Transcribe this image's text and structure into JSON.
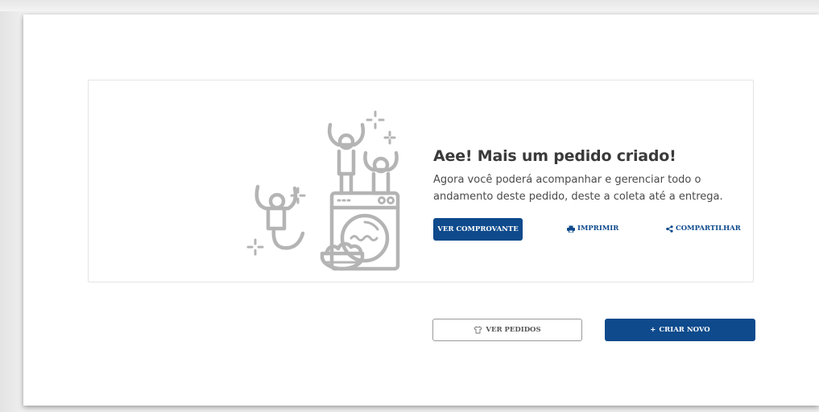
{
  "colors": {
    "primary": "#0e4a8c",
    "illustration": "#b4b4b4",
    "title": "#3a3a3a"
  },
  "success_card": {
    "illustration": "laundry-celebration-illustration",
    "title": "Aee! Mais um pedido criado!",
    "description": "Agora você poderá acompanhar e gerenciar todo o andamento deste pedido, deste a coleta até a entrega.",
    "actions": {
      "receipt_label": "VER COMPROVANTE",
      "print_label": "IMPRIMIR",
      "print_icon": "printer-icon",
      "share_label": "COMPARTILHAR",
      "share_icon": "share-icon"
    }
  },
  "footer_actions": {
    "orders_label": "VER PEDIDOS",
    "orders_icon": "shirt-icon",
    "create_label": "CRIAR NOVO",
    "create_icon": "plus-icon",
    "create_icon_glyph": "+"
  }
}
